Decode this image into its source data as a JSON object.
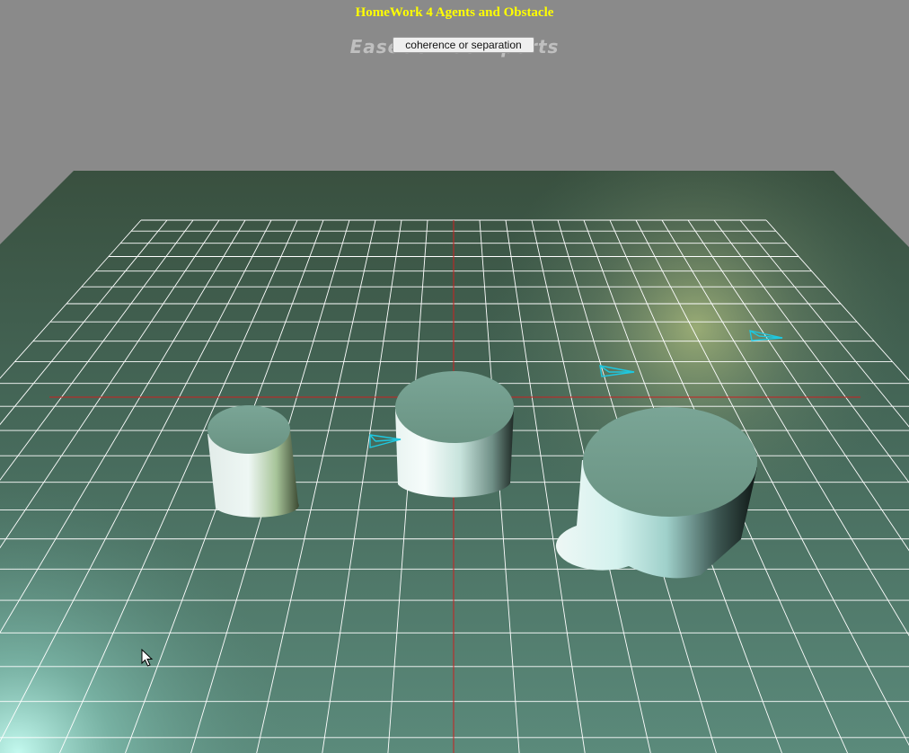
{
  "page": {
    "title": "HomeWork 4 Agents and Obstacle",
    "watermark": "EaseUS RecExperts"
  },
  "controls": {
    "mode_button_label": "coherence or separation"
  },
  "scene": {
    "background_color": "#8a8a8a",
    "floor_color": "#4f7466",
    "grid_color": "#ffffff",
    "axis_color": "#cc1f1f",
    "obstacle_color": "#d4efe6",
    "obstacle_top_color": "#6f9a89",
    "agent_color": "#1ec8e0",
    "obstacles": [
      {
        "name": "left-cylinder"
      },
      {
        "name": "center-cylinder"
      },
      {
        "name": "right-cylinder"
      }
    ],
    "agents": [
      {
        "name": "agent-1"
      },
      {
        "name": "agent-2"
      },
      {
        "name": "agent-3"
      }
    ]
  }
}
